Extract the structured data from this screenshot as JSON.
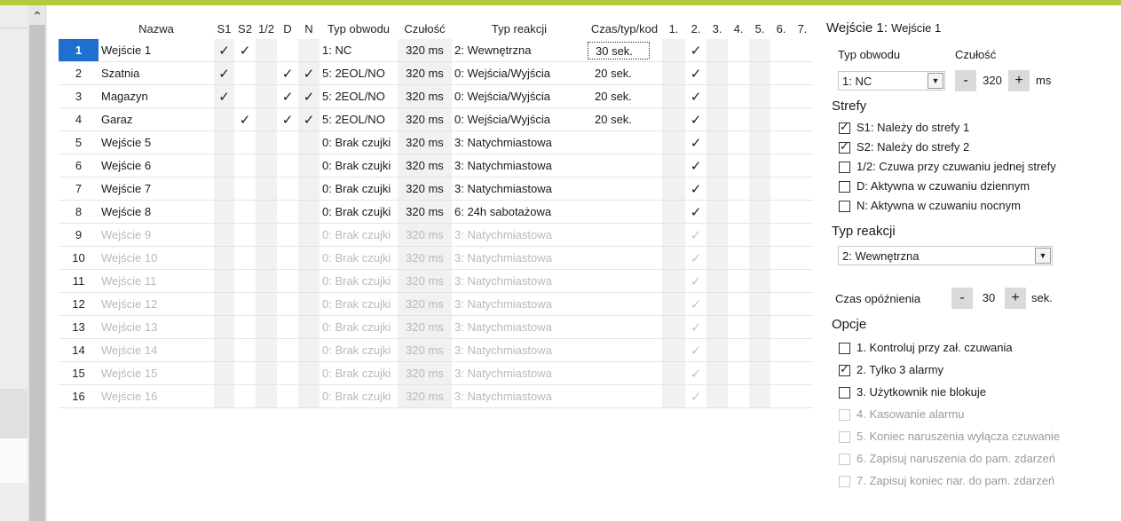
{
  "columns": [
    "Nazwa",
    "S1",
    "S2",
    "1/2",
    "D",
    "N",
    "Typ obwodu",
    "Czułość",
    "Typ reakcji",
    "Czas/typ/kod",
    "1.",
    "2.",
    "3.",
    "4.",
    "5.",
    "6.",
    "7."
  ],
  "check_glyph": "✓",
  "rows": [
    {
      "num": "1",
      "name": "Wejście  1",
      "s1": true,
      "s2": true,
      "half": false,
      "d": false,
      "n": false,
      "typ": "1: NC",
      "czulosc": "320 ms",
      "reakcja": "2: Wewnętrzna",
      "czas": "30 sek.",
      "o2": true,
      "dim": false,
      "active": true
    },
    {
      "num": "2",
      "name": "Szatnia",
      "s1": true,
      "s2": false,
      "half": false,
      "d": true,
      "n": true,
      "typ": "5: 2EOL/NO",
      "czulosc": "320 ms",
      "reakcja": "0: Wejścia/Wyjścia",
      "czas": "20 sek.",
      "o2": true,
      "dim": false,
      "active": false
    },
    {
      "num": "3",
      "name": "Magazyn",
      "s1": true,
      "s2": false,
      "half": false,
      "d": true,
      "n": true,
      "typ": "5: 2EOL/NO",
      "czulosc": "320 ms",
      "reakcja": "0: Wejścia/Wyjścia",
      "czas": "20 sek.",
      "o2": true,
      "dim": false,
      "active": false
    },
    {
      "num": "4",
      "name": "Garaz",
      "s1": false,
      "s2": true,
      "half": false,
      "d": true,
      "n": true,
      "typ": "5: 2EOL/NO",
      "czulosc": "320 ms",
      "reakcja": "0: Wejścia/Wyjścia",
      "czas": "20 sek.",
      "o2": true,
      "dim": false,
      "active": false
    },
    {
      "num": "5",
      "name": "Wejście  5",
      "s1": false,
      "s2": false,
      "half": false,
      "d": false,
      "n": false,
      "typ": "0: Brak czujki",
      "czulosc": "320 ms",
      "reakcja": "3: Natychmiastowa",
      "czas": "",
      "o2": true,
      "dim": false,
      "active": false
    },
    {
      "num": "6",
      "name": "Wejście  6",
      "s1": false,
      "s2": false,
      "half": false,
      "d": false,
      "n": false,
      "typ": "0: Brak czujki",
      "czulosc": "320 ms",
      "reakcja": "3: Natychmiastowa",
      "czas": "",
      "o2": true,
      "dim": false,
      "active": false
    },
    {
      "num": "7",
      "name": "Wejście  7",
      "s1": false,
      "s2": false,
      "half": false,
      "d": false,
      "n": false,
      "typ": "0: Brak czujki",
      "czulosc": "320 ms",
      "reakcja": "3: Natychmiastowa",
      "czas": "",
      "o2": true,
      "dim": false,
      "active": false
    },
    {
      "num": "8",
      "name": "Wejście  8",
      "s1": false,
      "s2": false,
      "half": false,
      "d": false,
      "n": false,
      "typ": "0: Brak czujki",
      "czulosc": "320 ms",
      "reakcja": "6: 24h sabotażowa",
      "czas": "",
      "o2": true,
      "dim": false,
      "active": false
    },
    {
      "num": "9",
      "name": "Wejście  9",
      "s1": false,
      "s2": false,
      "half": false,
      "d": false,
      "n": false,
      "typ": "0: Brak czujki",
      "czulosc": "320 ms",
      "reakcja": "3: Natychmiastowa",
      "czas": "",
      "o2": true,
      "dim": true,
      "active": false
    },
    {
      "num": "10",
      "name": "Wejście 10",
      "s1": false,
      "s2": false,
      "half": false,
      "d": false,
      "n": false,
      "typ": "0: Brak czujki",
      "czulosc": "320 ms",
      "reakcja": "3: Natychmiastowa",
      "czas": "",
      "o2": true,
      "dim": true,
      "active": false
    },
    {
      "num": "11",
      "name": "Wejście 11",
      "s1": false,
      "s2": false,
      "half": false,
      "d": false,
      "n": false,
      "typ": "0: Brak czujki",
      "czulosc": "320 ms",
      "reakcja": "3: Natychmiastowa",
      "czas": "",
      "o2": true,
      "dim": true,
      "active": false
    },
    {
      "num": "12",
      "name": "Wejście 12",
      "s1": false,
      "s2": false,
      "half": false,
      "d": false,
      "n": false,
      "typ": "0: Brak czujki",
      "czulosc": "320 ms",
      "reakcja": "3: Natychmiastowa",
      "czas": "",
      "o2": true,
      "dim": true,
      "active": false
    },
    {
      "num": "13",
      "name": "Wejście 13",
      "s1": false,
      "s2": false,
      "half": false,
      "d": false,
      "n": false,
      "typ": "0: Brak czujki",
      "czulosc": "320 ms",
      "reakcja": "3: Natychmiastowa",
      "czas": "",
      "o2": true,
      "dim": true,
      "active": false
    },
    {
      "num": "14",
      "name": "Wejście 14",
      "s1": false,
      "s2": false,
      "half": false,
      "d": false,
      "n": false,
      "typ": "0: Brak czujki",
      "czulosc": "320 ms",
      "reakcja": "3: Natychmiastowa",
      "czas": "",
      "o2": true,
      "dim": true,
      "active": false
    },
    {
      "num": "15",
      "name": "Wejście 15",
      "s1": false,
      "s2": false,
      "half": false,
      "d": false,
      "n": false,
      "typ": "0: Brak czujki",
      "czulosc": "320 ms",
      "reakcja": "3: Natychmiastowa",
      "czas": "",
      "o2": true,
      "dim": true,
      "active": false
    },
    {
      "num": "16",
      "name": "Wejście 16",
      "s1": false,
      "s2": false,
      "half": false,
      "d": false,
      "n": false,
      "typ": "0: Brak czujki",
      "czulosc": "320 ms",
      "reakcja": "3: Natychmiastowa",
      "czas": "",
      "o2": true,
      "dim": true,
      "active": false
    }
  ],
  "panel": {
    "title_prefix": "Wejście 1:",
    "title_name": "Wejście  1",
    "typ_obwodu_label": "Typ obwodu",
    "typ_obwodu_value": "1: NC",
    "czulosc_label": "Czułość",
    "czulosc_value": "320",
    "czulosc_unit": "ms",
    "minus": "-",
    "plus": "+",
    "strefy_label": "Strefy",
    "strefy": [
      {
        "label": "S1: Należy do strefy 1",
        "checked": true
      },
      {
        "label": "S2: Należy do strefy 2",
        "checked": true
      },
      {
        "label": "1/2: Czuwa przy czuwaniu jednej strefy",
        "checked": false
      },
      {
        "label": "D: Aktywna w czuwaniu dziennym",
        "checked": false
      },
      {
        "label": "N: Aktywna w czuwaniu nocnym",
        "checked": false
      }
    ],
    "typ_reakcji_label": "Typ reakcji",
    "typ_reakcji_value": "2: Wewnętrzna",
    "czas_label": "Czas opóźnienia",
    "czas_value": "30",
    "czas_unit": "sek.",
    "opcje_label": "Opcje",
    "opcje": [
      {
        "label": "1. Kontroluj przy zał. czuwania",
        "checked": false,
        "disabled": false
      },
      {
        "label": "2. Tylko 3 alarmy",
        "checked": true,
        "disabled": false
      },
      {
        "label": "3. Użytkownik nie blokuje",
        "checked": false,
        "disabled": false
      },
      {
        "label": "4. Kasowanie alarmu",
        "checked": false,
        "disabled": true
      },
      {
        "label": "5. Koniec naruszenia wyłącza czuwanie",
        "checked": false,
        "disabled": true
      },
      {
        "label": "6. Zapisuj naruszenia do pam. zdarzeń",
        "checked": false,
        "disabled": true
      },
      {
        "label": "7. Zapisuj koniec nar. do pam. zdarzeń",
        "checked": false,
        "disabled": true
      }
    ]
  }
}
